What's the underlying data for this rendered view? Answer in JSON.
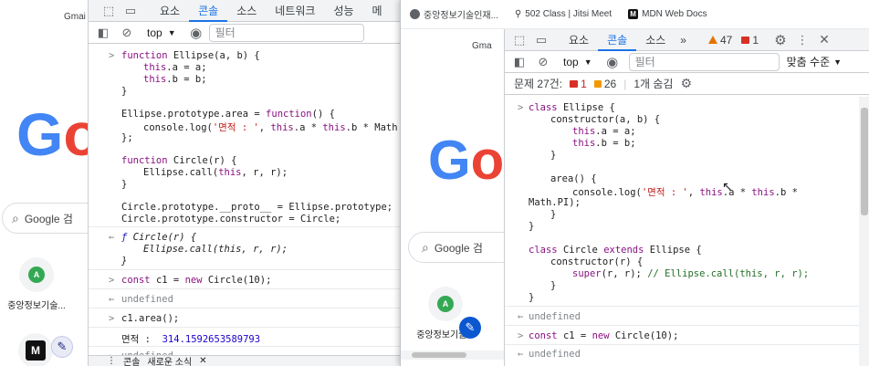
{
  "left_page": {
    "gmail_label": "Gmai",
    "search_placeholder": "Google 검",
    "shortcut_label": "중앙정보기술...",
    "shortcut_avatar": "A"
  },
  "left_devtools": {
    "tabs": [
      "요소",
      "콘솔",
      "소스",
      "네트워크",
      "성능",
      "메"
    ],
    "active_tab": "콘솔",
    "context": "top",
    "filter_placeholder": "필터",
    "drawer": [
      "콘솔",
      "새로운 소식"
    ],
    "lines": {
      "l1a": "function ",
      "l1b": "Ellipse",
      "l1c": "(a, b) {",
      "l2a": "this",
      "l2b": ".a = a;",
      "l3a": "this",
      "l3b": ".b = b;",
      "l4": "}",
      "l5a": "Ellipse.prototype.area = ",
      "l5b": "function",
      "l5c": "() {",
      "l6a": "console.log(",
      "l6b": "'면적 : '",
      "l6c": ", ",
      "l6d": "this",
      "l6e": ".a * ",
      "l6f": "this",
      "l6g": ".b * Math.PI",
      "l7": "};",
      "l8a": "function ",
      "l8b": "Circle",
      "l8c": "(r) {",
      "l9a": "Ellipse.call(",
      "l9b": "this",
      "l9c": ", r, r);",
      "l10": "}",
      "l11": "Circle.prototype.__proto__ = Ellipse.prototype;",
      "l12": "Circle.prototype.constructor = Circle;",
      "r1a": "ƒ ",
      "r1b": "Circle(r) {",
      "r2": "Ellipse.call(this, r, r);",
      "r3": "}",
      "c2a": "const ",
      "c2b": "c1",
      "c2c": " = ",
      "c2d": "new ",
      "c2e": "Circle(10);",
      "u1": "undefined",
      "c3": "c1.area();",
      "o1a": "면적 :  ",
      "o1b": "314.1592653589793",
      "u2": "undefined"
    }
  },
  "right_window": {
    "bookmarks": [
      "중앙정보기술인재...",
      "502 Class | Jitsi Meet",
      "MDN Web Docs"
    ],
    "gmail_label": "Gma",
    "search_placeholder": "Google 검",
    "shortcut_label": "중앙정보기술...",
    "shortcut_avatar": "A",
    "devtools": {
      "tabs": [
        "요소",
        "콘솔",
        "소스"
      ],
      "active_tab": "콘솔",
      "more": "»",
      "warn_count": "47",
      "err_count": "1",
      "context": "top",
      "filter_placeholder": "필터",
      "level": "맞춤 수준",
      "issues_label": "문제 27건:",
      "issues_err": "1",
      "issues_warn": "26",
      "hidden": "1개 숨김",
      "lines": {
        "k1a": "class ",
        "k1b": "Ellipse",
        "k1c": " {",
        "k2a": "constructor",
        "k2b": "(a, b) {",
        "k3a": "this",
        "k3b": ".a = a;",
        "k4a": "this",
        "k4b": ".b = b;",
        "k5": "}",
        "k6": "area() {",
        "k7a": "console.log(",
        "k7b": "'면적 : '",
        "k7c": ", ",
        "k7d": "this",
        "k7e": ".a * ",
        "k7f": "this",
        "k7g": ".b *",
        "k8": "Math.PI);",
        "k9": "}",
        "k10": "}",
        "k11a": "class ",
        "k11b": "Circle",
        "k11c": " extends ",
        "k11d": "Ellipse",
        "k11e": " {",
        "k12a": "constructor",
        "k12b": "(r) {",
        "k13a": "super",
        "k13b": "(r, r); ",
        "k13c": "// Ellipse.call(this, r, r);",
        "k14": "}",
        "k15": "}",
        "u1": "undefined",
        "c1a": "const ",
        "c1b": "c1",
        "c1c": " = ",
        "c1d": "new ",
        "c1e": "Circle(10);",
        "u2": "undefined"
      }
    }
  },
  "colors": {
    "accent": "#1a73e8",
    "keyword": "#881280",
    "string": "#c41a16",
    "number": "#1c00cf",
    "error": "#d93025",
    "warning": "#e37400"
  }
}
